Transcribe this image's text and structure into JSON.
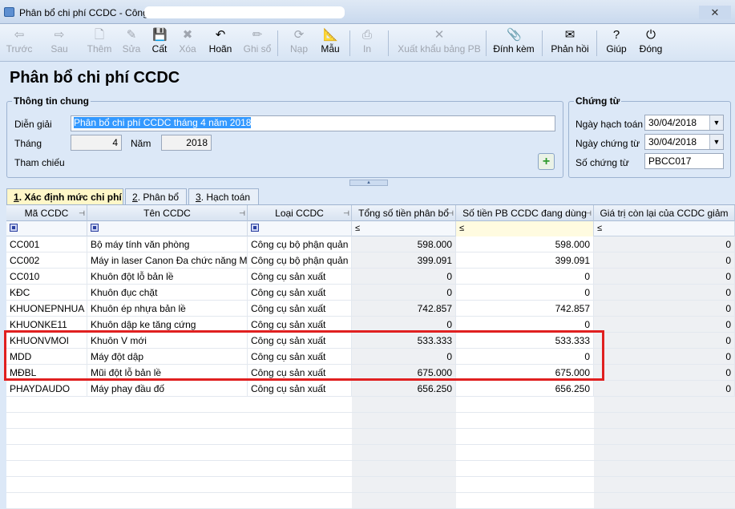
{
  "window": {
    "title": "Phân bổ chi phí CCDC - Công",
    "close_glyph": "✕"
  },
  "toolbar": [
    {
      "name": "back",
      "label": "Trước",
      "icon": "arrow-left-icon",
      "glyph": "⇦",
      "enabled": false
    },
    {
      "name": "next",
      "label": "Sau",
      "icon": "arrow-right-icon",
      "glyph": "⇨",
      "enabled": false
    },
    {
      "name": "add",
      "label": "Thêm",
      "icon": "new-doc-icon",
      "glyph": "🗋",
      "enabled": false
    },
    {
      "name": "edit",
      "label": "Sửa",
      "icon": "edit-doc-icon",
      "glyph": "✎",
      "enabled": false
    },
    {
      "name": "save",
      "label": "Cất",
      "icon": "save-icon",
      "glyph": "💾",
      "enabled": true
    },
    {
      "name": "delete",
      "label": "Xóa",
      "icon": "delete-icon",
      "glyph": "✖",
      "enabled": false
    },
    {
      "name": "undo",
      "label": "Hoãn",
      "icon": "undo-icon",
      "glyph": "↶",
      "enabled": true
    },
    {
      "name": "post",
      "label": "Ghi sổ",
      "icon": "pencil-icon",
      "glyph": "✏",
      "enabled": false
    },
    {
      "name": "load",
      "label": "Nạp",
      "icon": "load-icon",
      "glyph": "⟳",
      "enabled": false
    },
    {
      "name": "template",
      "label": "Mẫu",
      "icon": "ruler-icon",
      "glyph": "📐",
      "enabled": true
    },
    {
      "name": "print",
      "label": "In",
      "icon": "printer-icon",
      "glyph": "⎙",
      "enabled": false
    },
    {
      "name": "export",
      "label": "Xuất khẩu bảng PB",
      "icon": "excel-icon",
      "glyph": "✕",
      "enabled": false
    },
    {
      "name": "attach",
      "label": "Đính kèm",
      "icon": "paperclip-icon",
      "glyph": "📎",
      "enabled": true
    },
    {
      "name": "feedback",
      "label": "Phản hồi",
      "icon": "mail-icon",
      "glyph": "✉",
      "enabled": true
    },
    {
      "name": "help",
      "label": "Giúp",
      "icon": "help-icon",
      "glyph": "?",
      "enabled": true
    },
    {
      "name": "close",
      "label": "Đóng",
      "icon": "power-icon",
      "glyph": "⏻",
      "enabled": true
    }
  ],
  "page_title": "Phân bổ chi phí CCDC",
  "general": {
    "legend": "Thông tin chung",
    "description_label": "Diễn giải",
    "description_value": "Phân bổ chi phí CCDC tháng 4 năm 2018",
    "month_label": "Tháng",
    "month_value": "4",
    "year_label": "Năm",
    "year_value": "2018",
    "reference_label": "Tham chiếu",
    "add_glyph": "+"
  },
  "voucher": {
    "legend": "Chứng từ",
    "posting_date_label": "Ngày hạch toán",
    "posting_date_value": "30/04/2018",
    "voucher_date_label": "Ngày chứng từ",
    "voucher_date_value": "30/04/2018",
    "voucher_no_label": "Số chứng từ",
    "voucher_no_value": "PBCC017",
    "dropdown_glyph": "▼"
  },
  "collapse_glyph": "▲",
  "tabs": [
    {
      "key": "1",
      "label": ". Xác định mức chi phí",
      "active": true
    },
    {
      "key": "2",
      "label": ". Phân bổ",
      "active": false
    },
    {
      "key": "3",
      "label": ". Hạch toán",
      "active": false
    }
  ],
  "grid": {
    "pin_glyph": "⊣",
    "filter_op": "≤",
    "columns": [
      "Mã CCDC",
      "Tên CCDC",
      "Loại CCDC",
      "Tổng số tiền phân bổ",
      "Số tiền PB CCDC đang dùng",
      "Giá trị còn lại của CCDC giảm"
    ],
    "rows": [
      [
        "CC001",
        "Bộ máy tính văn phòng",
        "Công cụ bộ phận quản l",
        "598.000",
        "598.000",
        "0"
      ],
      [
        "CC002",
        "Máy in laser Canon Đa chức năng MF",
        "Công cụ bộ phận quản l",
        "399.091",
        "399.091",
        "0"
      ],
      [
        "CC010",
        "Khuôn đột lỗ bản lề",
        "Công cụ sản xuất",
        "0",
        "0",
        "0"
      ],
      [
        "KĐC",
        "Khuôn đục chặt",
        "Công cụ sản xuất",
        "0",
        "0",
        "0"
      ],
      [
        "KHUONEPNHUA",
        "Khuôn ép nhựa bản lề",
        "Công cụ sản xuất",
        "742.857",
        "742.857",
        "0"
      ],
      [
        "KHUONKE11",
        "Khuôn dập ke tăng cứng",
        "Công cụ sản xuất",
        "0",
        "0",
        "0"
      ],
      [
        "KHUONVMOI",
        "Khuôn V mới",
        "Công cụ sản xuất",
        "533.333",
        "533.333",
        "0"
      ],
      [
        "MDD",
        "Máy đột dập",
        "Công cụ sản xuất",
        "0",
        "0",
        "0"
      ],
      [
        "MĐBL",
        "Mũi đột lỗ bản lề",
        "Công cụ sản xuất",
        "675.000",
        "675.000",
        "0"
      ],
      [
        "PHAYDAUDO",
        "Máy phay đầu đố",
        "Công cụ sản xuất",
        "656.250",
        "656.250",
        "0"
      ]
    ]
  },
  "colors": {
    "highlight_border": "#e02020",
    "active_tab": "#fff7c8",
    "selection": "#3399ff"
  }
}
